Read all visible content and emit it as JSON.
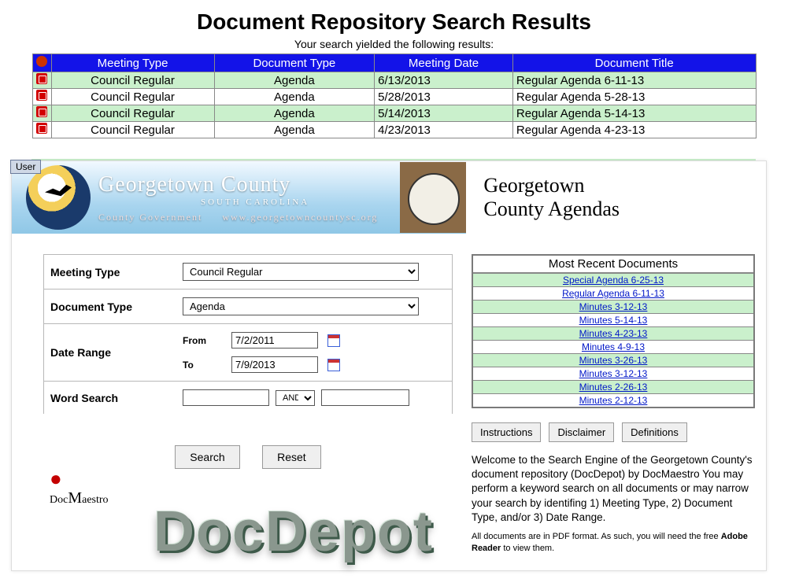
{
  "page_title": "Document Repository Search Results",
  "results_intro": "Your search yielded the following results:",
  "results_headers": {
    "meeting_type": "Meeting Type",
    "document_type": "Document Type",
    "meeting_date": "Meeting Date",
    "document_title": "Document Title"
  },
  "results_rows": [
    {
      "meeting_type": "Council Regular",
      "document_type": "Agenda",
      "meeting_date": "6/13/2013",
      "document_title": "Regular Agenda 6-11-13",
      "alt": true
    },
    {
      "meeting_type": "Council Regular",
      "document_type": "Agenda",
      "meeting_date": "5/28/2013",
      "document_title": "Regular Agenda 5-28-13",
      "alt": false
    },
    {
      "meeting_type": "Council Regular",
      "document_type": "Agenda",
      "meeting_date": "5/14/2013",
      "document_title": "Regular Agenda 5-14-13",
      "alt": true
    },
    {
      "meeting_type": "Council Regular",
      "document_type": "Agenda",
      "meeting_date": "4/23/2013",
      "document_title": "Regular Agenda 4-23-13",
      "alt": false
    }
  ],
  "user_tab": "User",
  "banner": {
    "county": "Georgetown County",
    "state": "SOUTH CAROLINA",
    "gov_line1": "County",
    "gov_line2": "Government",
    "url": "www.georgetowncountysc.org",
    "right_title_1": "Georgetown",
    "right_title_2": "County Agendas"
  },
  "form": {
    "meeting_type_label": "Meeting Type",
    "meeting_type_value": "Council Regular",
    "document_type_label": "Document Type",
    "document_type_value": "Agenda",
    "date_range_label": "Date Range",
    "from_label": "From",
    "from_value": "7/2/2011",
    "to_label": "To",
    "to_value": "7/9/2013",
    "word_search_label": "Word Search",
    "andor_value": "AND",
    "search_btn": "Search",
    "reset_btn": "Reset"
  },
  "docmaestro_brand": "DocMaestro",
  "docdepot_brand": "DocDepot",
  "recent": {
    "title": "Most Recent Documents",
    "items": [
      "Special Agenda 6-25-13",
      "Regular Agenda 6-11-13",
      "Minutes 3-12-13",
      "Minutes 5-14-13",
      "Minutes 4-23-13",
      "Minutes 4-9-13",
      "Minutes 3-26-13",
      "Minutes 3-12-13",
      "Minutes 2-26-13",
      "Minutes 2-12-13"
    ]
  },
  "info_buttons": {
    "instructions": "Instructions",
    "disclaimer": "Disclaimer",
    "definitions": "Definitions"
  },
  "welcome_text": "Welcome to the Search Engine of the Georgetown County's document repository (DocDepot) by DocMaestro  You may perform a keyword search on all documents or may narrow your search by identifing 1) Meeting Type, 2) Document Type, and/or 3) Date Range.",
  "welcome_fine_1": "All documents are in PDF format. As such, you will need the free ",
  "welcome_fine_bold": "Adobe Reader",
  "welcome_fine_2": " to view them."
}
